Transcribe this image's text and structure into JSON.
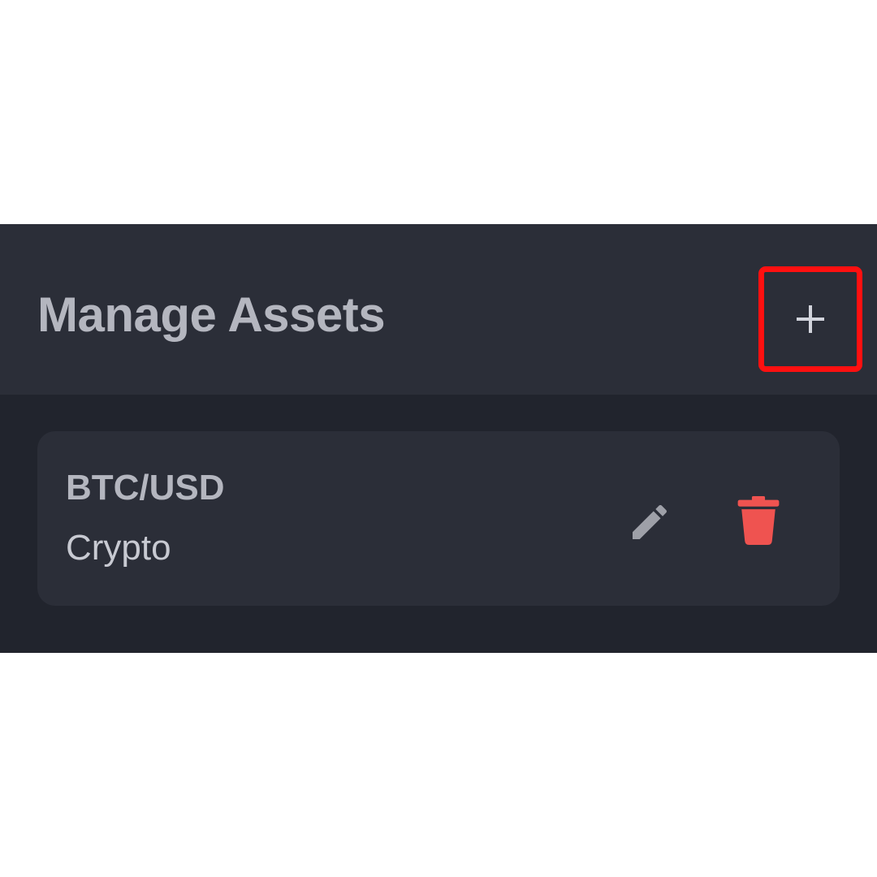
{
  "header": {
    "title": "Manage Assets",
    "add_icon": "plus-icon"
  },
  "assets": [
    {
      "symbol": "BTC/USD",
      "category": "Crypto",
      "edit_icon": "pencil-icon",
      "delete_icon": "trash-icon"
    }
  ],
  "colors": {
    "panel_background": "#21242d",
    "header_background": "#2b2e38",
    "card_background": "#2b2e38",
    "text_primary": "#b4b6bf",
    "delete_accent": "#ef5350",
    "highlight_border": "#ff1010"
  }
}
